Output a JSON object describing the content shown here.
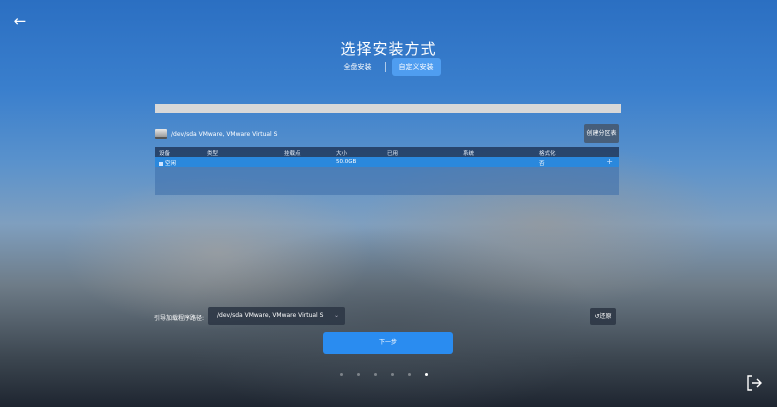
{
  "page": {
    "title": "选择安装方式"
  },
  "icons": {
    "back": "arrow-left-icon",
    "disk": "hard-disk-icon",
    "exit": "logout-icon",
    "dropdown": "chevron-down-icon",
    "restore": "undo-icon",
    "add": "plus-icon"
  },
  "modes": {
    "full_disk": "全盘安装",
    "custom": "自定义安装",
    "selected": "custom"
  },
  "disk": {
    "label": "/dev/sda VMware, VMware Virtual S",
    "create_partition_table": "创建分区表"
  },
  "table": {
    "headers": [
      "设备",
      "类型",
      "挂载点",
      "大小",
      "已用",
      "系统",
      "格式化"
    ],
    "rows": [
      {
        "device": "空闲",
        "type": "",
        "mount": "",
        "size": "50.0GB",
        "used": "",
        "system": "",
        "format": "否"
      }
    ]
  },
  "boot": {
    "label": "引导加载程序路径:",
    "value": "/dev/sda VMware, VMware Virtual S"
  },
  "buttons": {
    "restore": "还原",
    "next": "下一步"
  },
  "steps": {
    "total": 6,
    "current": 6
  },
  "colors": {
    "accent": "#2a8cf0",
    "selected_row": "#2a88dd",
    "mode_active": "#4f9df0"
  }
}
